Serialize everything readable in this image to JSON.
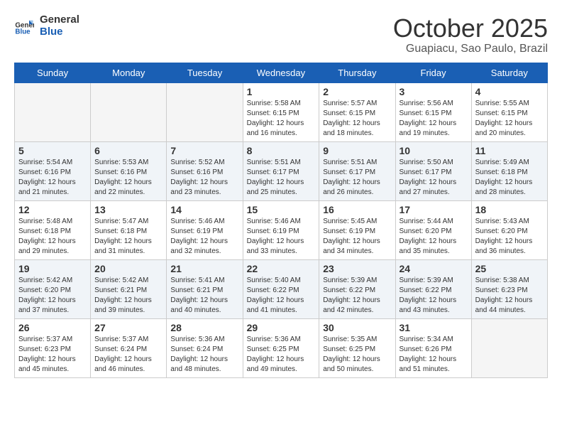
{
  "header": {
    "logo": {
      "line1": "General",
      "line2": "Blue"
    },
    "title": "October 2025",
    "location": "Guapiacu, Sao Paulo, Brazil"
  },
  "weekdays": [
    "Sunday",
    "Monday",
    "Tuesday",
    "Wednesday",
    "Thursday",
    "Friday",
    "Saturday"
  ],
  "weeks": [
    [
      {
        "day": null
      },
      {
        "day": null
      },
      {
        "day": null
      },
      {
        "day": "1",
        "sunrise": "5:58 AM",
        "sunset": "6:15 PM",
        "daylight": "12 hours and 16 minutes."
      },
      {
        "day": "2",
        "sunrise": "5:57 AM",
        "sunset": "6:15 PM",
        "daylight": "12 hours and 18 minutes."
      },
      {
        "day": "3",
        "sunrise": "5:56 AM",
        "sunset": "6:15 PM",
        "daylight": "12 hours and 19 minutes."
      },
      {
        "day": "4",
        "sunrise": "5:55 AM",
        "sunset": "6:15 PM",
        "daylight": "12 hours and 20 minutes."
      }
    ],
    [
      {
        "day": "5",
        "sunrise": "5:54 AM",
        "sunset": "6:16 PM",
        "daylight": "12 hours and 21 minutes."
      },
      {
        "day": "6",
        "sunrise": "5:53 AM",
        "sunset": "6:16 PM",
        "daylight": "12 hours and 22 minutes."
      },
      {
        "day": "7",
        "sunrise": "5:52 AM",
        "sunset": "6:16 PM",
        "daylight": "12 hours and 23 minutes."
      },
      {
        "day": "8",
        "sunrise": "5:51 AM",
        "sunset": "6:17 PM",
        "daylight": "12 hours and 25 minutes."
      },
      {
        "day": "9",
        "sunrise": "5:51 AM",
        "sunset": "6:17 PM",
        "daylight": "12 hours and 26 minutes."
      },
      {
        "day": "10",
        "sunrise": "5:50 AM",
        "sunset": "6:17 PM",
        "daylight": "12 hours and 27 minutes."
      },
      {
        "day": "11",
        "sunrise": "5:49 AM",
        "sunset": "6:18 PM",
        "daylight": "12 hours and 28 minutes."
      }
    ],
    [
      {
        "day": "12",
        "sunrise": "5:48 AM",
        "sunset": "6:18 PM",
        "daylight": "12 hours and 29 minutes."
      },
      {
        "day": "13",
        "sunrise": "5:47 AM",
        "sunset": "6:18 PM",
        "daylight": "12 hours and 31 minutes."
      },
      {
        "day": "14",
        "sunrise": "5:46 AM",
        "sunset": "6:19 PM",
        "daylight": "12 hours and 32 minutes."
      },
      {
        "day": "15",
        "sunrise": "5:46 AM",
        "sunset": "6:19 PM",
        "daylight": "12 hours and 33 minutes."
      },
      {
        "day": "16",
        "sunrise": "5:45 AM",
        "sunset": "6:19 PM",
        "daylight": "12 hours and 34 minutes."
      },
      {
        "day": "17",
        "sunrise": "5:44 AM",
        "sunset": "6:20 PM",
        "daylight": "12 hours and 35 minutes."
      },
      {
        "day": "18",
        "sunrise": "5:43 AM",
        "sunset": "6:20 PM",
        "daylight": "12 hours and 36 minutes."
      }
    ],
    [
      {
        "day": "19",
        "sunrise": "5:42 AM",
        "sunset": "6:20 PM",
        "daylight": "12 hours and 37 minutes."
      },
      {
        "day": "20",
        "sunrise": "5:42 AM",
        "sunset": "6:21 PM",
        "daylight": "12 hours and 39 minutes."
      },
      {
        "day": "21",
        "sunrise": "5:41 AM",
        "sunset": "6:21 PM",
        "daylight": "12 hours and 40 minutes."
      },
      {
        "day": "22",
        "sunrise": "5:40 AM",
        "sunset": "6:22 PM",
        "daylight": "12 hours and 41 minutes."
      },
      {
        "day": "23",
        "sunrise": "5:39 AM",
        "sunset": "6:22 PM",
        "daylight": "12 hours and 42 minutes."
      },
      {
        "day": "24",
        "sunrise": "5:39 AM",
        "sunset": "6:22 PM",
        "daylight": "12 hours and 43 minutes."
      },
      {
        "day": "25",
        "sunrise": "5:38 AM",
        "sunset": "6:23 PM",
        "daylight": "12 hours and 44 minutes."
      }
    ],
    [
      {
        "day": "26",
        "sunrise": "5:37 AM",
        "sunset": "6:23 PM",
        "daylight": "12 hours and 45 minutes."
      },
      {
        "day": "27",
        "sunrise": "5:37 AM",
        "sunset": "6:24 PM",
        "daylight": "12 hours and 46 minutes."
      },
      {
        "day": "28",
        "sunrise": "5:36 AM",
        "sunset": "6:24 PM",
        "daylight": "12 hours and 48 minutes."
      },
      {
        "day": "29",
        "sunrise": "5:36 AM",
        "sunset": "6:25 PM",
        "daylight": "12 hours and 49 minutes."
      },
      {
        "day": "30",
        "sunrise": "5:35 AM",
        "sunset": "6:25 PM",
        "daylight": "12 hours and 50 minutes."
      },
      {
        "day": "31",
        "sunrise": "5:34 AM",
        "sunset": "6:26 PM",
        "daylight": "12 hours and 51 minutes."
      },
      {
        "day": null
      }
    ]
  ],
  "labels": {
    "sunrise": "Sunrise:",
    "sunset": "Sunset:",
    "daylight": "Daylight:"
  }
}
